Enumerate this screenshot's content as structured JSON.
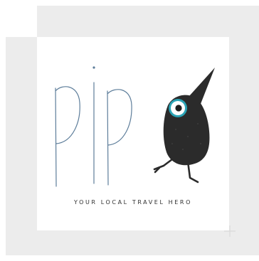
{
  "logo": {
    "wordmark": "pip",
    "tagline": "YOUR LOCAL TRAVEL HERO",
    "icon": "bird-mascot-icon"
  },
  "colors": {
    "outer_background": "#ececec",
    "card_background": "#ffffff",
    "letter_stroke": "#5d7d9a",
    "bird_body": "#2b2b2b",
    "bird_eye_ring": "#2aa3b5",
    "tagline_text": "#2f2f2f"
  }
}
